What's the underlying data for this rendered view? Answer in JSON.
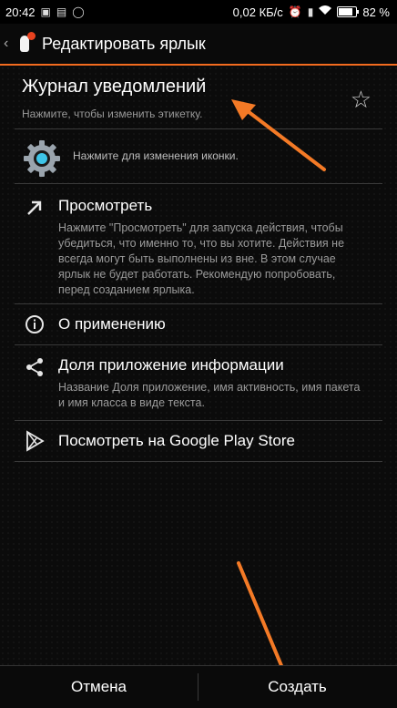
{
  "status_bar": {
    "time": "20:42",
    "net_speed": "0,02 КБ/с",
    "battery_percent": "82 %",
    "battery_level": 0.82,
    "icons": [
      "image-icon",
      "message-icon",
      "whatsapp-icon",
      "alarm-icon",
      "sim-icon",
      "wifi-icon",
      "battery-icon"
    ]
  },
  "action_bar": {
    "title": "Редактировать ярлык",
    "back_glyph": "‹"
  },
  "label": {
    "title": "Журнал уведомлений",
    "hint": "Нажмите, чтобы изменить этикетку."
  },
  "icon_row": {
    "hint": "Нажмите для изменения иконки."
  },
  "items": [
    {
      "icon": "open-arrow-icon",
      "title": "Просмотреть",
      "desc": "Нажмите \"Просмотреть\" для запуска действия, чтобы убедиться, что именно то, что вы хотите. Действия не всегда могут быть выполнены из вне. В этом случае ярлык не будет работать. Рекомендую попробовать, перед созданием ярлыка."
    },
    {
      "icon": "info-icon",
      "title": "О применению"
    },
    {
      "icon": "share-icon",
      "title": "Доля приложение информации",
      "desc": "Название Доля приложение, имя активность, имя пакета и имя класса в виде текста."
    },
    {
      "icon": "play-store-icon",
      "title": "Посмотреть на Google Play Store"
    }
  ],
  "buttons": {
    "cancel": "Отмена",
    "create": "Создать"
  },
  "colors": {
    "accent": "#f26b1f",
    "arrow": "#f47a26",
    "background": "#0b0b0b"
  }
}
